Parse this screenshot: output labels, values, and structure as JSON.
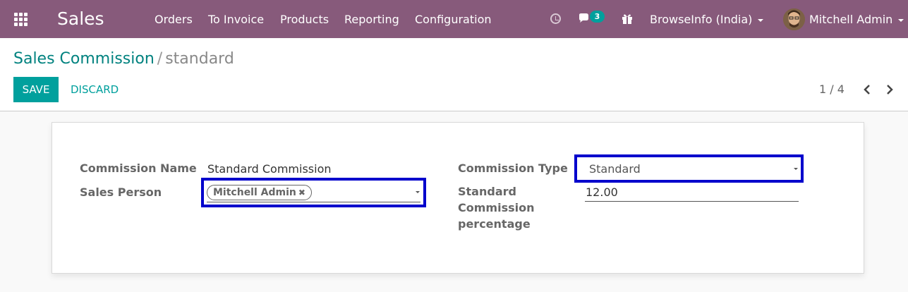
{
  "navbar": {
    "app_name": "Sales",
    "menu": [
      "Orders",
      "To Invoice",
      "Products",
      "Reporting",
      "Configuration"
    ],
    "chat_badge": "3",
    "company": "BrowseInfo (India)",
    "user": "Mitchell Admin",
    "icons": [
      "apps-grid-icon",
      "clock-icon",
      "chat-icon",
      "gift-icon"
    ],
    "bg_color": "#875a7b"
  },
  "breadcrumb": {
    "parent": "Sales Commission",
    "separator": "/",
    "current": "standard"
  },
  "buttons": {
    "save": "SAVE",
    "discard": "DISCARD"
  },
  "pager": {
    "value": "1 / 4"
  },
  "form": {
    "commission_name_label": "Commission Name",
    "commission_name_value": "Standard Commission",
    "sales_person_label": "Sales Person",
    "sales_person_tag": "Mitchell Admin",
    "tag_remove": "✖",
    "commission_type_label": "Commission Type",
    "commission_type_value": "Standard",
    "std_pct_label_line1": "Standard",
    "std_pct_label_line2": "Commission",
    "std_pct_label_line3": "percentage",
    "std_pct_value": "12.00"
  },
  "colors": {
    "accent": "#00a09d",
    "link": "#00827f",
    "highlight": "#0000cc"
  }
}
